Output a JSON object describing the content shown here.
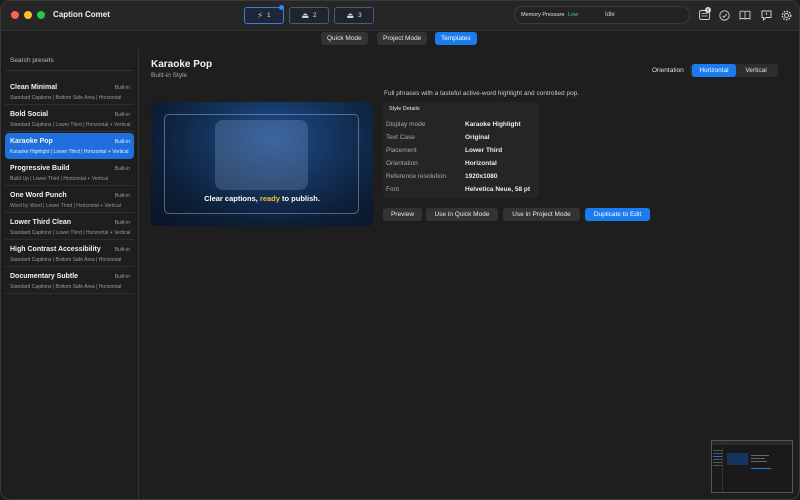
{
  "app": {
    "title": "Caption Comet"
  },
  "jobs": [
    {
      "icon": "bolt-icon",
      "glyph": "⚡",
      "count": "1"
    },
    {
      "icon": "tray-icon",
      "glyph": "⏏",
      "count": "2"
    },
    {
      "icon": "tray-icon",
      "glyph": "⏏",
      "count": "3"
    }
  ],
  "memory": {
    "label": "Memory Pressure",
    "value": "Low",
    "status": "Idle"
  },
  "toolbar_icons": [
    "checklist-icon",
    "speedometer-icon",
    "book-icon",
    "feedback-icon",
    "gear-icon"
  ],
  "toolbar_badge": "0",
  "modes": [
    "Quick Mode",
    "Project Mode",
    "Templates"
  ],
  "active_mode": "Templates",
  "sidebar": {
    "search_placeholder": "Search presets",
    "presets": [
      {
        "name": "Clean Minimal",
        "tag": "Built-in",
        "desc": "Standard Captions | Bottom Safe Area | Horizontal"
      },
      {
        "name": "Bold Social",
        "tag": "Built-in",
        "desc": "Standard Captions | Lower Third | Horizontal + Vertical"
      },
      {
        "name": "Karaoke Pop",
        "tag": "Built-in",
        "desc": "Karaoke Highlight | Lower Third | Horizontal + Vertical",
        "active": true
      },
      {
        "name": "Progressive Build",
        "tag": "Built-in",
        "desc": "Build Up | Lower Third | Horizontal + Vertical"
      },
      {
        "name": "One Word Punch",
        "tag": "Built-in",
        "desc": "Word by Word | Lower Third | Horizontal + Vertical"
      },
      {
        "name": "Lower Third Clean",
        "tag": "Built-in",
        "desc": "Standard Captions | Lower Third | Horizontal + Vertical"
      },
      {
        "name": "High Contrast Accessibility",
        "tag": "Built-in",
        "desc": "Standard Captions | Bottom Safe Area | Horizontal"
      },
      {
        "name": "Documentary Subtle",
        "tag": "Built-in",
        "desc": "Standard Captions | Bottom Safe Area | Horizontal"
      }
    ]
  },
  "main": {
    "title": "Karaoke Pop",
    "subtitle": "Built-in Style",
    "orientation_label": "Orientation",
    "orientation_options": [
      "Horizontal",
      "Vertical"
    ],
    "orientation_selected": "Horizontal",
    "preview_caption": {
      "before": "Clear captions, ",
      "highlight": "ready",
      "after": " to publish."
    },
    "description": "Full phrases with a tasteful active-word highlight and controlled pop.",
    "details_title": "Style Details",
    "details": [
      {
        "key": "Display mode",
        "value": "Karaoke Highlight"
      },
      {
        "key": "Text Case",
        "value": "Original"
      },
      {
        "key": "Placement",
        "value": "Lower Third"
      },
      {
        "key": "Orientation",
        "value": "Horizontal"
      },
      {
        "key": "Reference resolution",
        "value": "1920x1080"
      },
      {
        "key": "Font",
        "value": "Helvetica Neue, 58 pt"
      }
    ],
    "actions": [
      "Preview",
      "Use in Quick Mode",
      "Use in Project Mode",
      "Duplicate to Edit"
    ]
  },
  "colors": {
    "accent": "#1b7cf0",
    "highlight": "#f4c430",
    "memory_ok": "#4fd06c"
  }
}
